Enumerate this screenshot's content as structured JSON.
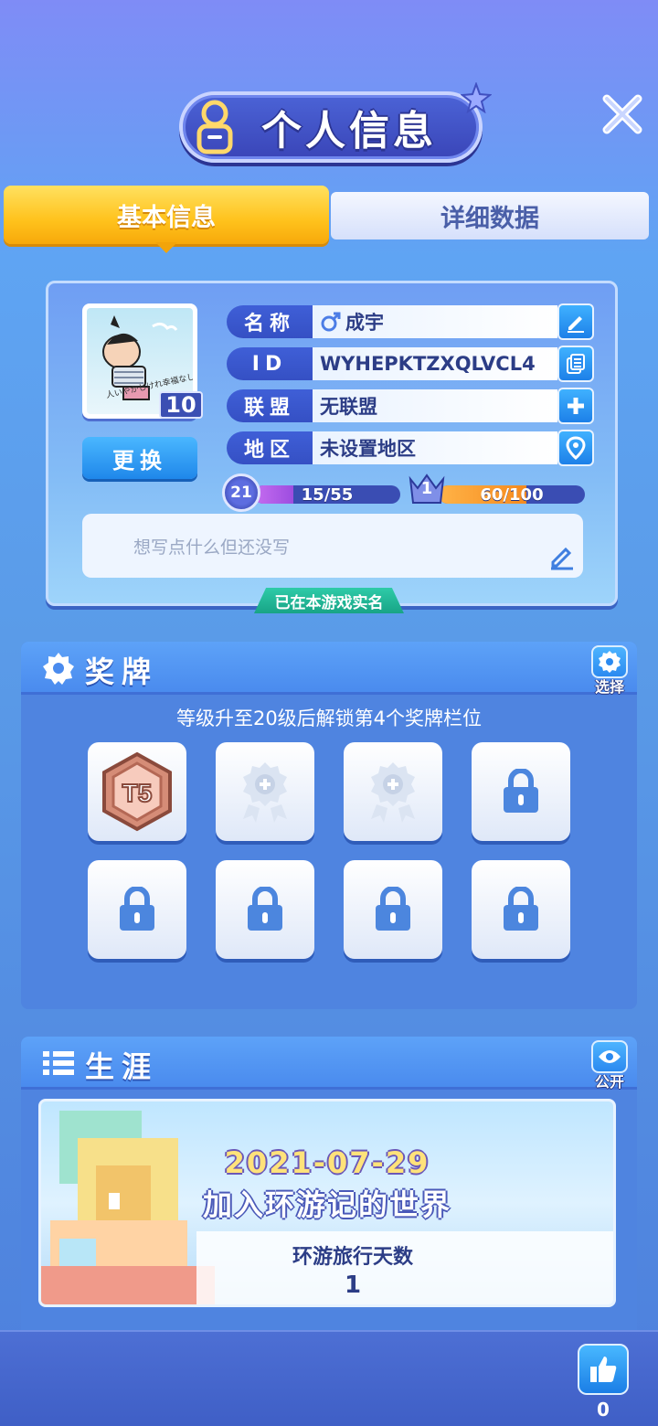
{
  "header": {
    "title": "个人信息"
  },
  "tabs": [
    {
      "label": "基本信息",
      "active": true
    },
    {
      "label": "详细数据",
      "active": false
    }
  ],
  "profile": {
    "level": "10",
    "change_label": "更换",
    "rows": [
      {
        "label": "名称",
        "value": "成宇",
        "action_icon": "edit-icon"
      },
      {
        "label": "ID",
        "value": "WYHEPKTZXQLVCL4",
        "action_icon": "copy-icon"
      },
      {
        "label": "联盟",
        "value": "无联盟",
        "action_icon": "plus-icon"
      },
      {
        "label": "地区",
        "value": "未设置地区",
        "action_icon": "location-icon"
      }
    ],
    "rank_level": "21",
    "exp_text": "15/55",
    "exp_fraction": 0.27,
    "crown_level": "1",
    "crown_text": "60/100",
    "crown_fraction": 0.6,
    "signature_placeholder": "想写点什么但还没写",
    "verified_text": "已在本游戏实名",
    "avatar_caption": "人いやかしけれ幸福なし"
  },
  "medals": {
    "title": "奖牌",
    "select_label": "选择",
    "hint": "等级升至20级后解锁第4个奖牌栏位",
    "badge_text": "T5",
    "slots": [
      "medal-t5",
      "empty",
      "empty",
      "locked",
      "locked",
      "locked",
      "locked",
      "locked"
    ]
  },
  "career": {
    "title": "生涯",
    "public_label": "公开",
    "date": "2021-07-29",
    "caption": "加入环游记的世界",
    "days_label": "环游旅行天数",
    "days_value": "1"
  },
  "footer": {
    "like_count": "0"
  },
  "colors": {
    "accent": "#ffc21c",
    "primary_blue": "#3f5fd7",
    "verified_green": "#18a486"
  }
}
